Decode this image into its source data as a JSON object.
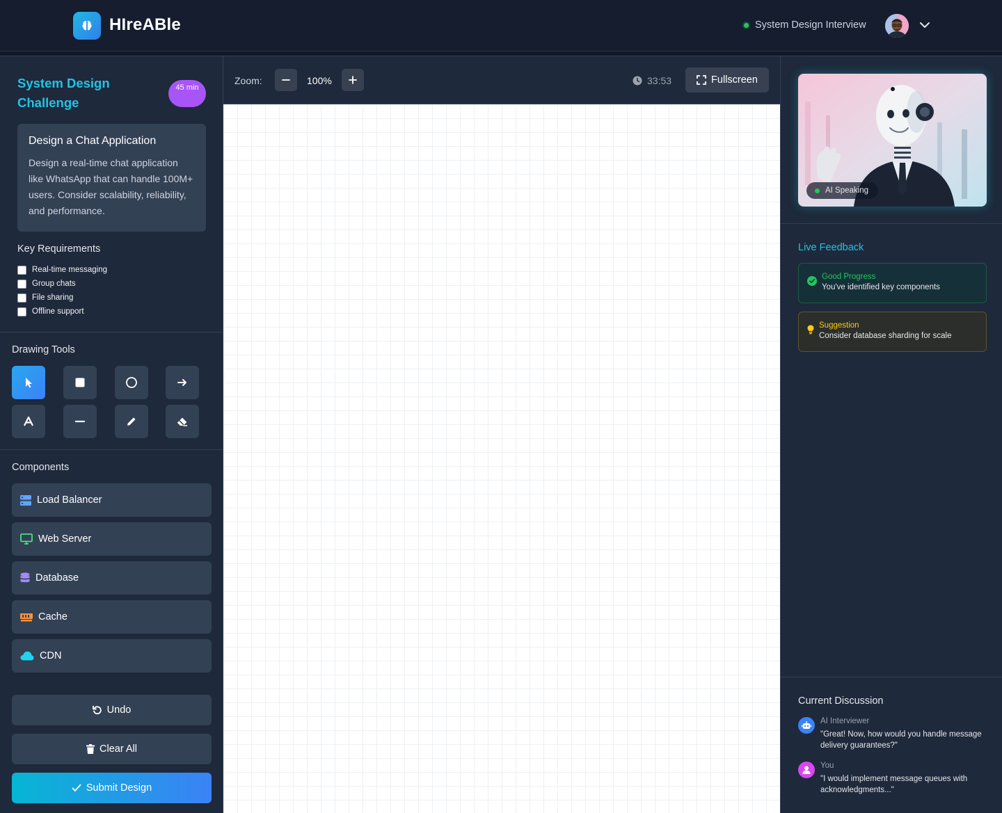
{
  "header": {
    "app_name": "HIreABle",
    "session_label": "System Design Interview"
  },
  "sidebar": {
    "challenge_title": "System Design Challenge",
    "time_badge": "45 min",
    "problem": {
      "title": "Design a Chat Application",
      "description": "Design a real-time chat application like WhatsApp that can handle 100M+ users. Consider scalability, reliability, and performance."
    },
    "requirements_title": "Key Requirements",
    "requirements": [
      {
        "label": "Real-time messaging",
        "checked": false
      },
      {
        "label": "Group chats",
        "checked": false
      },
      {
        "label": "File sharing",
        "checked": false
      },
      {
        "label": "Offline support",
        "checked": false
      }
    ],
    "tools_title": "Drawing Tools",
    "tools": [
      {
        "name": "select",
        "icon": "cursor-icon",
        "active": true
      },
      {
        "name": "rectangle",
        "icon": "square-icon",
        "active": false
      },
      {
        "name": "circle",
        "icon": "circle-icon",
        "active": false
      },
      {
        "name": "arrow",
        "icon": "arrow-right-icon",
        "active": false
      },
      {
        "name": "text",
        "icon": "text-icon",
        "active": false
      },
      {
        "name": "line",
        "icon": "minus-icon",
        "active": false
      },
      {
        "name": "pen",
        "icon": "pencil-icon",
        "active": false
      },
      {
        "name": "eraser",
        "icon": "eraser-icon",
        "active": false
      }
    ],
    "components_title": "Components",
    "components": [
      {
        "label": "Load Balancer",
        "icon": "server-icon",
        "color": "#60a5fa"
      },
      {
        "label": "Web Server",
        "icon": "desktop-icon",
        "color": "#4ade80"
      },
      {
        "label": "Database",
        "icon": "database-icon",
        "color": "#a78bfa"
      },
      {
        "label": "Cache",
        "icon": "memory-icon",
        "color": "#fb923c"
      },
      {
        "label": "CDN",
        "icon": "cloud-icon",
        "color": "#22d3ee"
      }
    ],
    "undo_label": "Undo",
    "clear_label": "Clear All",
    "submit_label": "Submit Design"
  },
  "toolbar": {
    "zoom_label": "Zoom:",
    "zoom_value": "100%",
    "timer": "33:53",
    "fullscreen_label": "Fullscreen"
  },
  "right": {
    "speaking_label": "AI Speaking",
    "live_feedback_title": "Live Feedback",
    "feedback": [
      {
        "type": "good",
        "title": "Good Progress",
        "text": "You've identified key components"
      },
      {
        "type": "suggestion",
        "title": "Suggestion",
        "text": "Consider database sharding for scale"
      }
    ],
    "discussion_title": "Current Discussion",
    "messages": [
      {
        "author": "AI Interviewer",
        "text": "\"Great! Now, how would you handle message delivery guarantees?\""
      },
      {
        "author": "You",
        "text": "\"I would implement message queues with acknowledgments...\""
      }
    ]
  },
  "colors": {
    "accent": "#22c3e6",
    "brand_gradient_start": "#06b6d4",
    "brand_gradient_end": "#3b82f6",
    "badge": "#a855f7",
    "good": "#22c55e",
    "suggestion": "#facc15"
  }
}
